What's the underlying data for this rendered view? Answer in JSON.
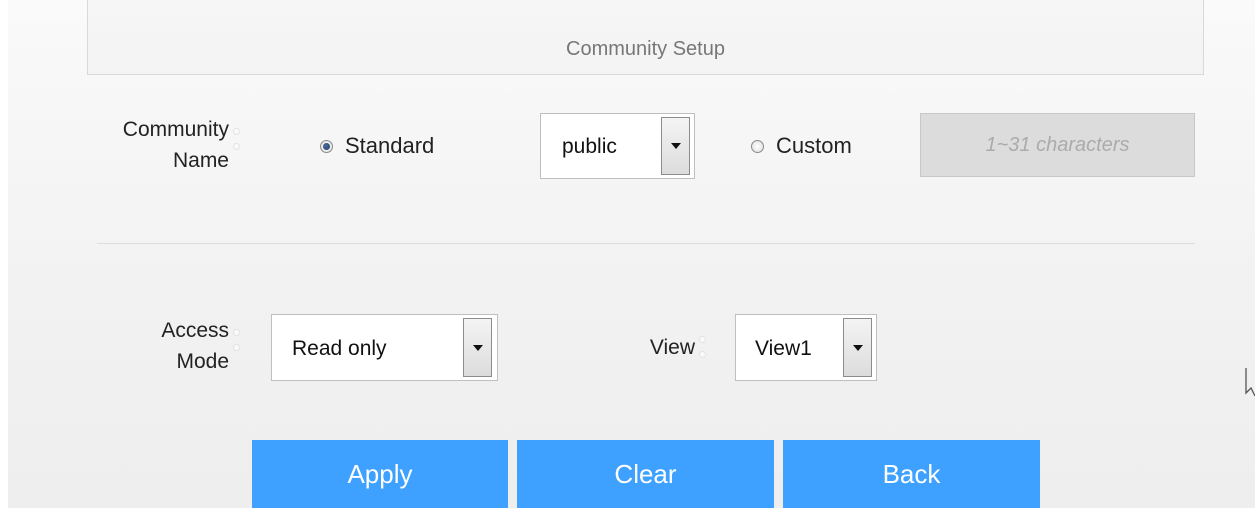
{
  "header": {
    "title": "Community Setup"
  },
  "community_name": {
    "label_line1": "Community",
    "label_line2": "Name",
    "standard_label": "Standard",
    "standard_selected": true,
    "standard_value": "public",
    "custom_label": "Custom",
    "custom_selected": false,
    "custom_placeholder": "1~31 characters"
  },
  "access": {
    "label_line1": "Access",
    "label_line2": "Mode",
    "mode_value": "Read only",
    "view_label": "View",
    "view_value": "View1"
  },
  "buttons": {
    "apply": "Apply",
    "clear": "Clear",
    "back": "Back"
  },
  "colors": {
    "button": "#3ea1ff",
    "radio_dot": "#2a4d7a"
  }
}
